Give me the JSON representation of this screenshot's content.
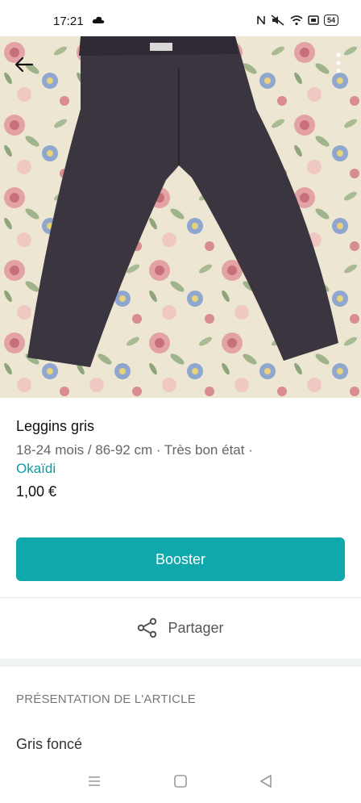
{
  "status_bar": {
    "time": "17:21",
    "battery": "54"
  },
  "listing": {
    "title": "Leggins gris",
    "meta": "18-24 mois / 86-92 cm · Très bon état ·",
    "brand": "Okaïdi",
    "price": "1,00 €"
  },
  "actions": {
    "booster_label": "Booster",
    "share_label": "Partager"
  },
  "section": {
    "title": "PRÉSENTATION DE L'ARTICLE",
    "description": "Gris foncé"
  },
  "colors": {
    "accent": "#0fa8ad",
    "brand_link": "#0a9ba6",
    "garment": "#3b3540"
  },
  "icons": [
    "cloud-icon",
    "nfc-icon",
    "mute-icon",
    "wifi-icon",
    "cast-icon",
    "battery-icon",
    "back-arrow-icon",
    "more-vertical-icon",
    "share-icon",
    "nav-menu-icon",
    "nav-home-icon",
    "nav-back-icon"
  ]
}
